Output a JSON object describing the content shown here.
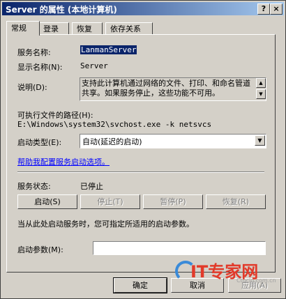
{
  "window": {
    "title": "Server 的属性 (本地计算机)",
    "help": "?",
    "close": "×"
  },
  "tabs": [
    {
      "label": "常规"
    },
    {
      "label": "登录"
    },
    {
      "label": "恢复"
    },
    {
      "label": "依存关系"
    }
  ],
  "general": {
    "service_name_label": "服务名称:",
    "service_name_value": "LanmanServer",
    "display_name_label": "显示名称(N):",
    "display_name_value": "Server",
    "description_label": "说明(D):",
    "description_value": "支持此计算机通过网络的文件、打印、和命名管道共享。如果服务停止，这些功能不可用。",
    "exe_path_label": "可执行文件的路径(H):",
    "exe_path_value": "E:\\Windows\\system32\\svchost.exe -k netsvcs",
    "startup_type_label": "启动类型(E):",
    "startup_type_value": "自动(延迟的启动)",
    "help_link": "帮助我配置服务启动选项。",
    "status_label": "服务状态:",
    "status_value": "已停止",
    "start_button": "启动(S)",
    "stop_button": "停止(T)",
    "pause_button": "暂停(P)",
    "resume_button": "恢复(R)",
    "hint_text": "当从此处启动服务时，您可指定所适用的启动参数。",
    "params_label": "启动参数(M):",
    "params_value": ""
  },
  "footer": {
    "ok": "确定",
    "cancel": "取消",
    "apply": "应用(A)"
  },
  "watermark": {
    "main": "IT专家网",
    "sub": "Ctocio.com.cn"
  }
}
